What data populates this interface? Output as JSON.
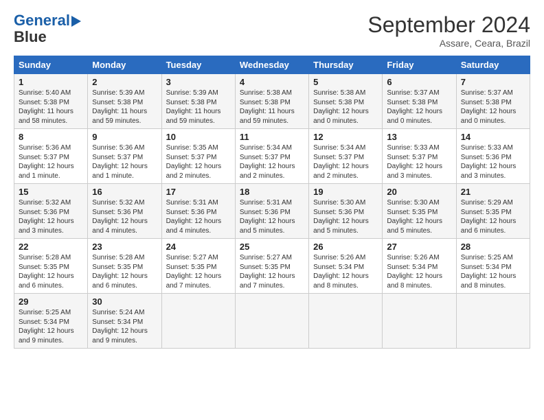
{
  "header": {
    "logo_line1": "General",
    "logo_line2": "Blue",
    "month": "September 2024",
    "location": "Assare, Ceara, Brazil"
  },
  "days_of_week": [
    "Sunday",
    "Monday",
    "Tuesday",
    "Wednesday",
    "Thursday",
    "Friday",
    "Saturday"
  ],
  "weeks": [
    [
      {
        "day": "1",
        "lines": [
          "Sunrise: 5:40 AM",
          "Sunset: 5:38 PM",
          "Daylight: 11 hours",
          "and 58 minutes."
        ]
      },
      {
        "day": "2",
        "lines": [
          "Sunrise: 5:39 AM",
          "Sunset: 5:38 PM",
          "Daylight: 11 hours",
          "and 59 minutes."
        ]
      },
      {
        "day": "3",
        "lines": [
          "Sunrise: 5:39 AM",
          "Sunset: 5:38 PM",
          "Daylight: 11 hours",
          "and 59 minutes."
        ]
      },
      {
        "day": "4",
        "lines": [
          "Sunrise: 5:38 AM",
          "Sunset: 5:38 PM",
          "Daylight: 11 hours",
          "and 59 minutes."
        ]
      },
      {
        "day": "5",
        "lines": [
          "Sunrise: 5:38 AM",
          "Sunset: 5:38 PM",
          "Daylight: 12 hours",
          "and 0 minutes."
        ]
      },
      {
        "day": "6",
        "lines": [
          "Sunrise: 5:37 AM",
          "Sunset: 5:38 PM",
          "Daylight: 12 hours",
          "and 0 minutes."
        ]
      },
      {
        "day": "7",
        "lines": [
          "Sunrise: 5:37 AM",
          "Sunset: 5:38 PM",
          "Daylight: 12 hours",
          "and 0 minutes."
        ]
      }
    ],
    [
      {
        "day": "8",
        "lines": [
          "Sunrise: 5:36 AM",
          "Sunset: 5:37 PM",
          "Daylight: 12 hours",
          "and 1 minute."
        ]
      },
      {
        "day": "9",
        "lines": [
          "Sunrise: 5:36 AM",
          "Sunset: 5:37 PM",
          "Daylight: 12 hours",
          "and 1 minute."
        ]
      },
      {
        "day": "10",
        "lines": [
          "Sunrise: 5:35 AM",
          "Sunset: 5:37 PM",
          "Daylight: 12 hours",
          "and 2 minutes."
        ]
      },
      {
        "day": "11",
        "lines": [
          "Sunrise: 5:34 AM",
          "Sunset: 5:37 PM",
          "Daylight: 12 hours",
          "and 2 minutes."
        ]
      },
      {
        "day": "12",
        "lines": [
          "Sunrise: 5:34 AM",
          "Sunset: 5:37 PM",
          "Daylight: 12 hours",
          "and 2 minutes."
        ]
      },
      {
        "day": "13",
        "lines": [
          "Sunrise: 5:33 AM",
          "Sunset: 5:37 PM",
          "Daylight: 12 hours",
          "and 3 minutes."
        ]
      },
      {
        "day": "14",
        "lines": [
          "Sunrise: 5:33 AM",
          "Sunset: 5:36 PM",
          "Daylight: 12 hours",
          "and 3 minutes."
        ]
      }
    ],
    [
      {
        "day": "15",
        "lines": [
          "Sunrise: 5:32 AM",
          "Sunset: 5:36 PM",
          "Daylight: 12 hours",
          "and 3 minutes."
        ]
      },
      {
        "day": "16",
        "lines": [
          "Sunrise: 5:32 AM",
          "Sunset: 5:36 PM",
          "Daylight: 12 hours",
          "and 4 minutes."
        ]
      },
      {
        "day": "17",
        "lines": [
          "Sunrise: 5:31 AM",
          "Sunset: 5:36 PM",
          "Daylight: 12 hours",
          "and 4 minutes."
        ]
      },
      {
        "day": "18",
        "lines": [
          "Sunrise: 5:31 AM",
          "Sunset: 5:36 PM",
          "Daylight: 12 hours",
          "and 5 minutes."
        ]
      },
      {
        "day": "19",
        "lines": [
          "Sunrise: 5:30 AM",
          "Sunset: 5:36 PM",
          "Daylight: 12 hours",
          "and 5 minutes."
        ]
      },
      {
        "day": "20",
        "lines": [
          "Sunrise: 5:30 AM",
          "Sunset: 5:35 PM",
          "Daylight: 12 hours",
          "and 5 minutes."
        ]
      },
      {
        "day": "21",
        "lines": [
          "Sunrise: 5:29 AM",
          "Sunset: 5:35 PM",
          "Daylight: 12 hours",
          "and 6 minutes."
        ]
      }
    ],
    [
      {
        "day": "22",
        "lines": [
          "Sunrise: 5:28 AM",
          "Sunset: 5:35 PM",
          "Daylight: 12 hours",
          "and 6 minutes."
        ]
      },
      {
        "day": "23",
        "lines": [
          "Sunrise: 5:28 AM",
          "Sunset: 5:35 PM",
          "Daylight: 12 hours",
          "and 6 minutes."
        ]
      },
      {
        "day": "24",
        "lines": [
          "Sunrise: 5:27 AM",
          "Sunset: 5:35 PM",
          "Daylight: 12 hours",
          "and 7 minutes."
        ]
      },
      {
        "day": "25",
        "lines": [
          "Sunrise: 5:27 AM",
          "Sunset: 5:35 PM",
          "Daylight: 12 hours",
          "and 7 minutes."
        ]
      },
      {
        "day": "26",
        "lines": [
          "Sunrise: 5:26 AM",
          "Sunset: 5:34 PM",
          "Daylight: 12 hours",
          "and 8 minutes."
        ]
      },
      {
        "day": "27",
        "lines": [
          "Sunrise: 5:26 AM",
          "Sunset: 5:34 PM",
          "Daylight: 12 hours",
          "and 8 minutes."
        ]
      },
      {
        "day": "28",
        "lines": [
          "Sunrise: 5:25 AM",
          "Sunset: 5:34 PM",
          "Daylight: 12 hours",
          "and 8 minutes."
        ]
      }
    ],
    [
      {
        "day": "29",
        "lines": [
          "Sunrise: 5:25 AM",
          "Sunset: 5:34 PM",
          "Daylight: 12 hours",
          "and 9 minutes."
        ]
      },
      {
        "day": "30",
        "lines": [
          "Sunrise: 5:24 AM",
          "Sunset: 5:34 PM",
          "Daylight: 12 hours",
          "and 9 minutes."
        ]
      },
      {
        "day": "",
        "lines": []
      },
      {
        "day": "",
        "lines": []
      },
      {
        "day": "",
        "lines": []
      },
      {
        "day": "",
        "lines": []
      },
      {
        "day": "",
        "lines": []
      }
    ]
  ]
}
